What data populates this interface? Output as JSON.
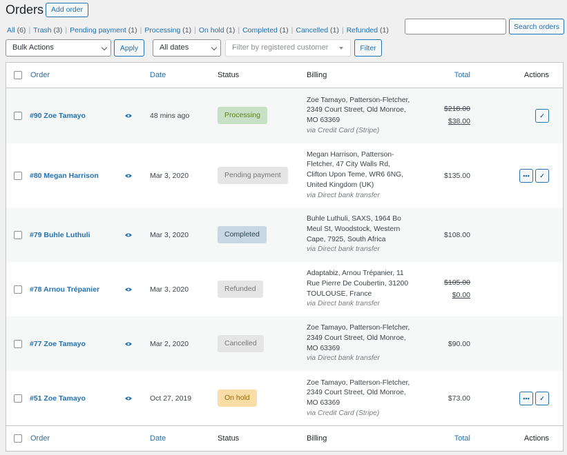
{
  "page": {
    "title": "Orders",
    "add_label": "Add order"
  },
  "filters": [
    {
      "label": "All",
      "count": "(6)"
    },
    {
      "label": "Trash",
      "count": "(3)"
    },
    {
      "label": "Pending payment",
      "count": "(1)"
    },
    {
      "label": "Processing",
      "count": "(1)"
    },
    {
      "label": "On hold",
      "count": "(1)"
    },
    {
      "label": "Completed",
      "count": "(1)"
    },
    {
      "label": "Cancelled",
      "count": "(1)"
    },
    {
      "label": "Refunded",
      "count": "(1)"
    }
  ],
  "search": {
    "value": "",
    "button": "Search orders"
  },
  "toolbar": {
    "bulk_actions": "Bulk Actions",
    "apply": "Apply",
    "dates": "All dates",
    "customer_placeholder": "Filter by registered customer",
    "filter": "Filter"
  },
  "columns": {
    "order": "Order",
    "date": "Date",
    "status": "Status",
    "billing": "Billing",
    "total": "Total",
    "actions": "Actions"
  },
  "colors": {
    "accent": "#2271b1"
  },
  "orders": [
    {
      "order": "#90 Zoe Tamayo",
      "date": "48 mins ago",
      "status": "Processing",
      "billing": [
        "Zoe Tamayo, Patterson-Fletcher,",
        "2349 Court Street, Old Monroe,",
        "MO 63369"
      ],
      "via": "via Credit Card (Stripe)",
      "total_old": "$218.00",
      "total": "$38.00",
      "actions": [
        "check"
      ]
    },
    {
      "order": "#80 Megan Harrison",
      "date": "Mar 3, 2020",
      "status": "Pending payment",
      "billing": [
        "Megan Harrison, Patterson-",
        "Fletcher, 47 City Walls Rd,",
        "Clifton Upon Teme, WR6 6NG,",
        "United Kingdom (UK)"
      ],
      "via": "via Direct bank transfer",
      "total_old": "",
      "total": "$135.00",
      "actions": [
        "more",
        "check"
      ]
    },
    {
      "order": "#79 Buhle Luthuli",
      "date": "Mar 3, 2020",
      "status": "Completed",
      "billing": [
        "Buhle Luthuli, SAXS, 1964 Bo",
        "Meul St, Woodstock, Western",
        "Cape, 7925, South Africa"
      ],
      "via": "via Direct bank transfer",
      "total_old": "",
      "total": "$108.00",
      "actions": []
    },
    {
      "order": "#78 Arnou Trépanier",
      "date": "Mar 3, 2020",
      "status": "Refunded",
      "billing": [
        "Adaptabiz, Arnou Trépanier, 11",
        "Rue Pierre De Coubertin, 31200",
        "TOULOUSE, France"
      ],
      "via": "via Direct bank transfer",
      "total_old": "$105.00",
      "total": "$0.00",
      "actions": []
    },
    {
      "order": "#77 Zoe Tamayo",
      "date": "Mar 2, 2020",
      "status": "Cancelled",
      "billing": [
        "Zoe Tamayo, Patterson-Fletcher,",
        "2349 Court Street, Old Monroe,",
        "MO 63369"
      ],
      "via": "via Direct bank transfer",
      "total_old": "",
      "total": "$90.00",
      "actions": []
    },
    {
      "order": "#51 Zoe Tamayo",
      "date": "Oct 27, 2019",
      "status": "On hold",
      "billing": [
        "Zoe Tamayo, Patterson-Fletcher,",
        "2349 Court Street, Old Monroe,",
        "MO 63369"
      ],
      "via": "via Credit Card (Stripe)",
      "total_old": "",
      "total": "$73.00",
      "actions": [
        "more",
        "check"
      ]
    }
  ]
}
